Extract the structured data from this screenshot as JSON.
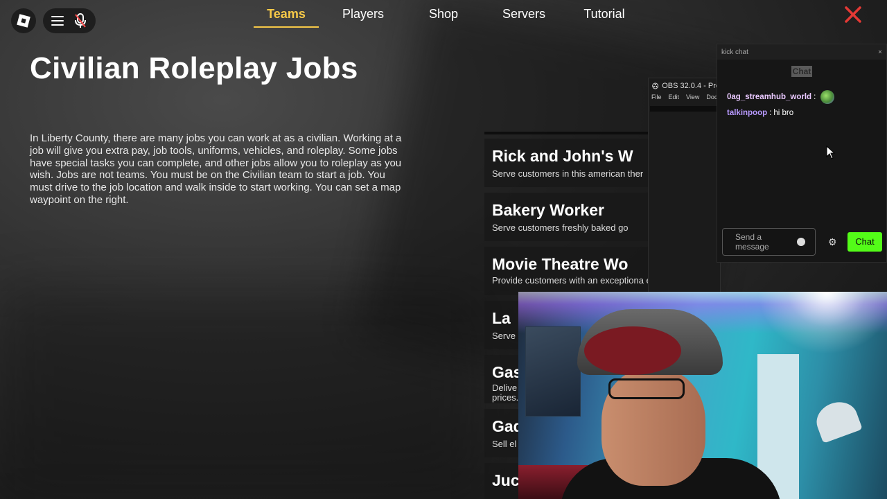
{
  "nav": {
    "tabs": [
      {
        "label": "Teams",
        "active": true
      },
      {
        "label": "Players",
        "active": false
      },
      {
        "label": "Shop",
        "active": false
      },
      {
        "label": "Servers",
        "active": false
      },
      {
        "label": "Tutorial",
        "active": false
      }
    ],
    "active_color": "#f7c948",
    "close_color": "#e53935"
  },
  "page": {
    "title": "Civilian Roleplay Jobs",
    "description": "In Liberty County, there are many jobs you can work at as a civilian. Working at a job will give you extra pay, job tools, uniforms, vehicles, and roleplay. Some jobs have special tasks you can complete, and other jobs allow you to roleplay as you wish. Jobs are not teams. You must be on the Civilian team to start a job. You must drive to the job location and walk inside to start working. You can set a map waypoint on the right."
  },
  "jobs": [
    {
      "title": "Rick and John's W",
      "desc": "Serve customers in this american ther"
    },
    {
      "title": "Bakery Worker",
      "desc": "Serve customers freshly baked go"
    },
    {
      "title": "Movie Theatre Wo",
      "desc": "Provide customers with an exceptiona experience"
    },
    {
      "title": "La",
      "desc": "Serve"
    },
    {
      "title": "Gas",
      "desc": "Delive prices."
    },
    {
      "title": "Gad",
      "desc": "Sell el"
    },
    {
      "title": "Juc",
      "desc": ""
    }
  ],
  "obs": {
    "title": "OBS 32.0.4 - Pro",
    "menu": [
      "File",
      "Edit",
      "View",
      "Doc"
    ]
  },
  "chat": {
    "window_title": "kick chat",
    "tab_label": "Chat",
    "messages": [
      {
        "user": "0ag_streamhub_world",
        "text": "",
        "has_emote": true
      },
      {
        "user": "talkinpoop",
        "text": "hi bro",
        "has_emote": false
      }
    ],
    "input_placeholder": "Send a message",
    "send_label": "Chat",
    "send_color": "#53fc18"
  }
}
